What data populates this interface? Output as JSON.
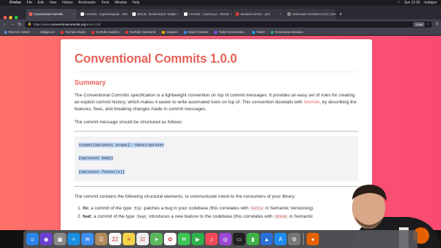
{
  "menubar": {
    "apple": "",
    "items": [
      "Firefox",
      "File",
      "Edit",
      "View",
      "History",
      "Bookmarks",
      "Tools",
      "Window",
      "Help"
    ],
    "clock": "Sun 12:39",
    "user": "makiges"
  },
  "tabs": [
    {
      "title": "Conventional Commits",
      "color": "#e8625a",
      "active": true
    },
    {
      "title": "Commits · angular/angular · GitH",
      "color": "#ffffff",
      "active": false
    },
    {
      "title": "GitHub - facebook/jest: Delight",
      "color": "#ffffff",
      "active": false
    },
    {
      "title": "Commits · nuxt/nuxt.js · GitHub",
      "color": "#ffffff",
      "active": false
    },
    {
      "title": "standard-version - npm",
      "color": "#cb3837",
      "active": false
    },
    {
      "title": "Versionado Semántico 2.0.0 | Sem",
      "color": "#888888",
      "active": false
    }
  ],
  "navbar": {
    "url_prefix": "https://www.",
    "url_domain": "conventionalcommits.org",
    "url_path": "/en/v1.0.0/",
    "zoom": "133%"
  },
  "bookmarks": [
    {
      "label": "Panel de Control",
      "color": "#5b8bd9"
    },
    {
      "label": "makiges.es",
      "color": "#4a4a4a"
    },
    {
      "label": "YouTube Studio",
      "color": "#e33"
    },
    {
      "label": "YouTube Analytics",
      "color": "#e33"
    },
    {
      "label": "YouTube Comments",
      "color": "#e33"
    },
    {
      "label": "Analytics",
      "color": "#f9ab00"
    },
    {
      "label": "Search Console",
      "color": "#4285f4"
    },
    {
      "label": "Twitch Stream Man...",
      "color": "#9146ff"
    },
    {
      "label": "Twitter",
      "color": "#1da1f2"
    },
    {
      "label": "Generadora miniatura",
      "color": "#3a7"
    }
  ],
  "page": {
    "title": "Conventional Commits 1.0.0",
    "summary_heading": "Summary",
    "intro_before": "The Conventional Commits specification is a lightweight convention on top of commit messages. It provides an easy set of rules for creating an explicit commit history; which makes it easier to write automated tools on top of. This convention dovetails with ",
    "semver_link": "SemVer",
    "intro_after": ", by describing the features, fixes, and breaking changes made in commit messages.",
    "structure_intro": "The commit message should be structured as follows:",
    "code_lines": [
      "<type>[optional scope]: <description>",
      "[optional body]",
      "[optional footer(s)]"
    ],
    "elements_intro": "The commit contains the following structural elements, to communicate intent to the consumers of your library:",
    "list": [
      {
        "term": "fix:",
        "t1": " a commit of the ",
        "em": "type",
        "kw": "fix",
        "t2": " patches a bug in your codebase (this correlates with ",
        "kw2": "PATCH",
        "t3": " in Semantic Versioning)."
      },
      {
        "term": "feat:",
        "t1": " a commit of the type ",
        "em": "",
        "kw": "feat",
        "t2": " introduces a new feature to the codebase (this correlates with ",
        "kw2": "MINOR",
        "t3": " in Semantic"
      }
    ]
  },
  "dock": [
    {
      "icon": "finder-icon",
      "color": "#2b84e8",
      "glyph": "☺"
    },
    {
      "icon": "siri-icon",
      "color": "#6b3fd1",
      "glyph": "◉"
    },
    {
      "icon": "launchpad-icon",
      "color": "#888",
      "glyph": "▦"
    },
    {
      "icon": "safari-icon",
      "color": "#1a8fe0",
      "glyph": "✧"
    },
    {
      "icon": "mail-icon",
      "color": "#3d8ef0",
      "glyph": "✉"
    },
    {
      "icon": "contacts-icon",
      "color": "#b08a5a",
      "glyph": "☰"
    },
    {
      "icon": "calendar-icon",
      "color": "#f5f5f5",
      "glyph": "22"
    },
    {
      "icon": "notes-icon",
      "color": "#f3d34a",
      "glyph": "≡"
    },
    {
      "icon": "reminders-icon",
      "color": "#eeeeee",
      "glyph": "☑"
    },
    {
      "icon": "maps-icon",
      "color": "#5cb85c",
      "glyph": "➤"
    },
    {
      "icon": "photos-icon",
      "color": "#ffffff",
      "glyph": "✿"
    },
    {
      "icon": "messages-icon",
      "color": "#3cc653",
      "glyph": "✉"
    },
    {
      "icon": "facetime-icon",
      "color": "#2fb24c",
      "glyph": "▶"
    },
    {
      "icon": "music-icon",
      "color": "#f04a5a",
      "glyph": "♫"
    },
    {
      "icon": "podcasts-icon",
      "color": "#9b48d6",
      "glyph": "◎"
    },
    {
      "icon": "tv-icon",
      "color": "#222222",
      "glyph": "▭"
    },
    {
      "icon": "numbers-icon",
      "color": "#3fb24a",
      "glyph": "▮"
    },
    {
      "icon": "keynote-icon",
      "color": "#2a6fd6",
      "glyph": "▲"
    },
    {
      "icon": "appstore-icon",
      "color": "#1e8bf0",
      "glyph": "A"
    },
    {
      "icon": "preferences-icon",
      "color": "#777",
      "glyph": "⚙"
    },
    {
      "icon": "firefox-icon",
      "color": "#e66000",
      "glyph": "●"
    }
  ]
}
